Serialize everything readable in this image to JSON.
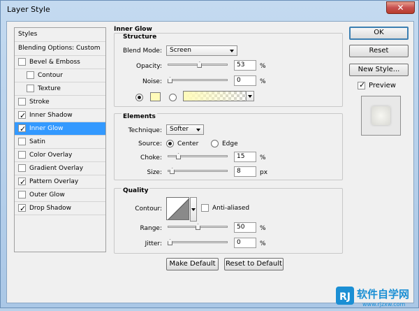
{
  "window": {
    "title": "Layer Style",
    "close_glyph": "✕"
  },
  "styles_list": {
    "header": "Styles",
    "blending": "Blending Options: Custom",
    "items": [
      {
        "label": "Bevel & Emboss",
        "checked": false,
        "indent": false
      },
      {
        "label": "Contour",
        "checked": false,
        "indent": true
      },
      {
        "label": "Texture",
        "checked": false,
        "indent": true
      },
      {
        "label": "Stroke",
        "checked": false,
        "indent": false
      },
      {
        "label": "Inner Shadow",
        "checked": true,
        "indent": false
      },
      {
        "label": "Inner Glow",
        "checked": true,
        "indent": false,
        "selected": true
      },
      {
        "label": "Satin",
        "checked": false,
        "indent": false
      },
      {
        "label": "Color Overlay",
        "checked": false,
        "indent": false
      },
      {
        "label": "Gradient Overlay",
        "checked": false,
        "indent": false
      },
      {
        "label": "Pattern Overlay",
        "checked": true,
        "indent": false
      },
      {
        "label": "Outer Glow",
        "checked": false,
        "indent": false
      },
      {
        "label": "Drop Shadow",
        "checked": true,
        "indent": false
      }
    ]
  },
  "inner_glow": {
    "title": "Inner Glow",
    "structure": {
      "title": "Structure",
      "blend_mode_label": "Blend Mode:",
      "blend_mode_value": "Screen",
      "opacity_label": "Opacity:",
      "opacity_value": "53",
      "opacity_unit": "%",
      "opacity_level": 0.53,
      "noise_label": "Noise:",
      "noise_value": "0",
      "noise_unit": "%",
      "noise_level": 0.0,
      "glow_color": "#fffbba",
      "use_color": true
    },
    "elements": {
      "title": "Elements",
      "technique_label": "Technique:",
      "technique_value": "Softer",
      "source_label": "Source:",
      "source_center": "Center",
      "source_edge": "Edge",
      "source_selected": "Center",
      "choke_label": "Choke:",
      "choke_value": "15",
      "choke_unit": "%",
      "choke_level": 0.15,
      "size_label": "Size:",
      "size_value": "8",
      "size_unit": "px",
      "size_level": 0.04
    },
    "quality": {
      "title": "Quality",
      "contour_label": "Contour:",
      "anti_aliased_label": "Anti-aliased",
      "anti_aliased": false,
      "range_label": "Range:",
      "range_value": "50",
      "range_unit": "%",
      "range_level": 0.5,
      "jitter_label": "Jitter:",
      "jitter_value": "0",
      "jitter_unit": "%",
      "jitter_level": 0.0
    },
    "make_default": "Make Default",
    "reset_default": "Reset to Default"
  },
  "buttons": {
    "ok": "OK",
    "reset": "Reset",
    "new_style": "New Style...",
    "preview_label": "Preview",
    "preview_checked": true
  },
  "watermark": {
    "logo": "RJ",
    "site": "软件自学网",
    "url": "www.rjzxw.com"
  },
  "colors": {
    "selection": "#3399ff",
    "glow": "#fffbba",
    "default_button_border": "#3c7fb1"
  }
}
